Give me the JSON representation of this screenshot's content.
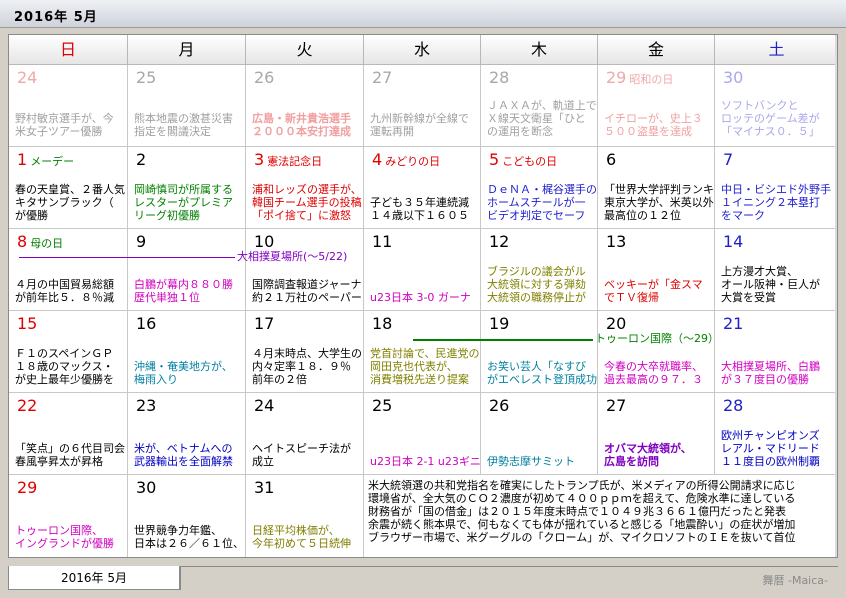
{
  "window_title": "2016年 5月",
  "weekdays": [
    "日",
    "月",
    "火",
    "水",
    "木",
    "金",
    "土"
  ],
  "tab_label": "2016年 5月",
  "brand": "舞暦 -Maica-",
  "days": {
    "d24": {
      "num": "24",
      "l1": "",
      "l2": "野村敏京選手が、今",
      "l3": "米女子ツアー優勝"
    },
    "d25": {
      "num": "25",
      "l1": "",
      "l2": "熊本地震の激甚災害",
      "l3": "指定を閣議決定"
    },
    "d26": {
      "num": "26",
      "l1": "",
      "l2": "広島・新井貴浩選手",
      "l3": "２０００本安打達成"
    },
    "d27": {
      "num": "27",
      "l1": "",
      "l2": "九州新幹線が全線で",
      "l3": "運転再開"
    },
    "d28": {
      "num": "28",
      "l1": "",
      "l2": "ＪＡＸＡが、軌道上で",
      "l3": "Ｘ線天文衛星「ひと",
      "l4": "の運用を断念"
    },
    "d29": {
      "num": "29",
      "hol": "昭和の日",
      "l2": "イチローが、史上３",
      "l3": "５００盗塁を達成"
    },
    "d30": {
      "num": "30",
      "l1": "ソフトバンクと",
      "l2": "ロッテのゲーム差が",
      "l3": "「マイナス０．５」"
    },
    "d1": {
      "num": "1",
      "hol": "メーデー",
      "l2": "春の天皇賞、２番人気",
      "l3": "キタサンブラック（",
      "l4": "が優勝"
    },
    "d2": {
      "num": "2",
      "l2": "岡崎慎司が所属する",
      "l3": "レスターがプレミア",
      "l4": "リーグ初優勝"
    },
    "d3": {
      "num": "3",
      "hol": "憲法記念日",
      "l2": "浦和レッズの選手が、",
      "l3": "韓国チーム選手の投稿",
      "l4": "「ポイ捨て」に激怒"
    },
    "d4": {
      "num": "4",
      "hol": "みどりの日",
      "l2": "子ども３５年連続減",
      "l3": "１４歳以下１６０５"
    },
    "d5": {
      "num": "5",
      "hol": "こどもの日",
      "l2": "ＤｅＮＡ・梶谷選手の",
      "l3": "ホームスチールが一",
      "l4": "ビデオ判定でセーフ"
    },
    "d6": {
      "num": "6",
      "l2": "「世界大学評判ランキ",
      "l3": "東京大学が、米英以外",
      "l4": "最高位の１２位"
    },
    "d7": {
      "num": "7",
      "l2": "中日・ビシエド外野手",
      "l3": "１イニング２本塁打",
      "l4": "をマーク"
    },
    "d8": {
      "num": "8",
      "hol": "母の日",
      "l2": "４月の中国貿易総額",
      "l3": "が前年比５．８％減"
    },
    "d9": {
      "num": "9",
      "l2": "白鵬が幕内８８０勝",
      "l3": "歴代単独１位"
    },
    "d10": {
      "num": "10",
      "l2": "国際調査報道ジャーナ",
      "l3": "約２１万社のペーパー"
    },
    "d11": {
      "num": "11",
      "l2": "u23日本 3-0 ガーナ"
    },
    "d12": {
      "num": "12",
      "l1": "ブラジルの議会がル",
      "l2": "大統領に対する弾劾",
      "l3": "大統領の職務停止が"
    },
    "d13": {
      "num": "13",
      "l2": "ベッキーが「金スマ",
      "l3": "でＴＶ復帰"
    },
    "d14": {
      "num": "14",
      "l1": "上方漫才大賞、",
      "l2": "オール阪神・巨人が",
      "l3": "大賞を受賞"
    },
    "d15": {
      "num": "15",
      "l1": "Ｆ１のスペインＧＰ",
      "l2": "１８歳のマックス・",
      "l3": "が史上最年少優勝を"
    },
    "d16": {
      "num": "16",
      "l2": "沖縄・奄美地方が、",
      "l3": "梅雨入り"
    },
    "d17": {
      "num": "17",
      "l1": "４月末時点、大学生の",
      "l2": "内々定率１８．９％",
      "l3": "前年の２倍"
    },
    "d18": {
      "num": "18",
      "l1": "党首討論で、民進党の",
      "l2": "岡田克也代表が、",
      "l3": "消費増税先送り提案"
    },
    "d19": {
      "num": "19",
      "l1": "",
      "l2": "お笑い芸人「なすび",
      "l3": "がエベレスト登頂成功"
    },
    "d20": {
      "num": "20",
      "l2": "今春の大卒就職率、",
      "l3": "過去最高の９７．３"
    },
    "d21": {
      "num": "21",
      "l2": "大相撲夏場所、白鵬",
      "l3": "が３７度目の優勝"
    },
    "d22": {
      "num": "22",
      "l2": "「笑点」の６代目司会",
      "l3": "春風亭昇太が昇格"
    },
    "d23": {
      "num": "23",
      "l2": "米が、ベトナムへの",
      "l3": "武器輸出を全面解禁"
    },
    "d24b": {
      "num": "24",
      "l2": "ヘイトスピーチ法が",
      "l3": "成立"
    },
    "d25b": {
      "num": "25",
      "l3": "u23日本 2-1 u23ギニ"
    },
    "d26b": {
      "num": "26",
      "l3": "伊勢志摩サミット"
    },
    "d27b": {
      "num": "27",
      "l2": "オバマ大統領が、",
      "l3": "広島を訪問"
    },
    "d28b": {
      "num": "28",
      "l1": "欧州チャンピオンズ",
      "l2": "レアル・マドリード",
      "l3": "１１度目の欧州制覇"
    },
    "d29b": {
      "num": "29",
      "l2": "トゥーロン国際、",
      "l3": "イングランドが優勝"
    },
    "d30b": {
      "num": "30",
      "l2": "世界競争力年鑑、",
      "l3": "日本は２６／６１位、"
    },
    "d31": {
      "num": "31",
      "l2": "日経平均株価が、",
      "l3": "今年初めて５日続伸"
    }
  },
  "events": {
    "sumo": "大相撲夏場所(～5/22)",
    "toulon": "トゥーロン国際（～29）"
  },
  "week6_news": [
    "米大統領選の共和党指名を確実にしたトランプ氏が、米メディアの所得公開請求に応じ",
    "環境省が、全大気のＣＯ２濃度が初めて４００ｐｐｍを超えて、危険水準に達している",
    "財務省が「国の借金」は２０１５年度末時点で１０４９兆３６６１億円だったと発表",
    "余震が続く熊本県で、何もなくても体が揺れていると感じる「地震酔い」の症状が増加",
    "ブラウザー市場で、米グーグルの「クローム」が、マイクロソフトのＩＥを抜いて首位"
  ],
  "colors": {
    "sunday": "#e00000",
    "saturday": "#2020d0"
  }
}
